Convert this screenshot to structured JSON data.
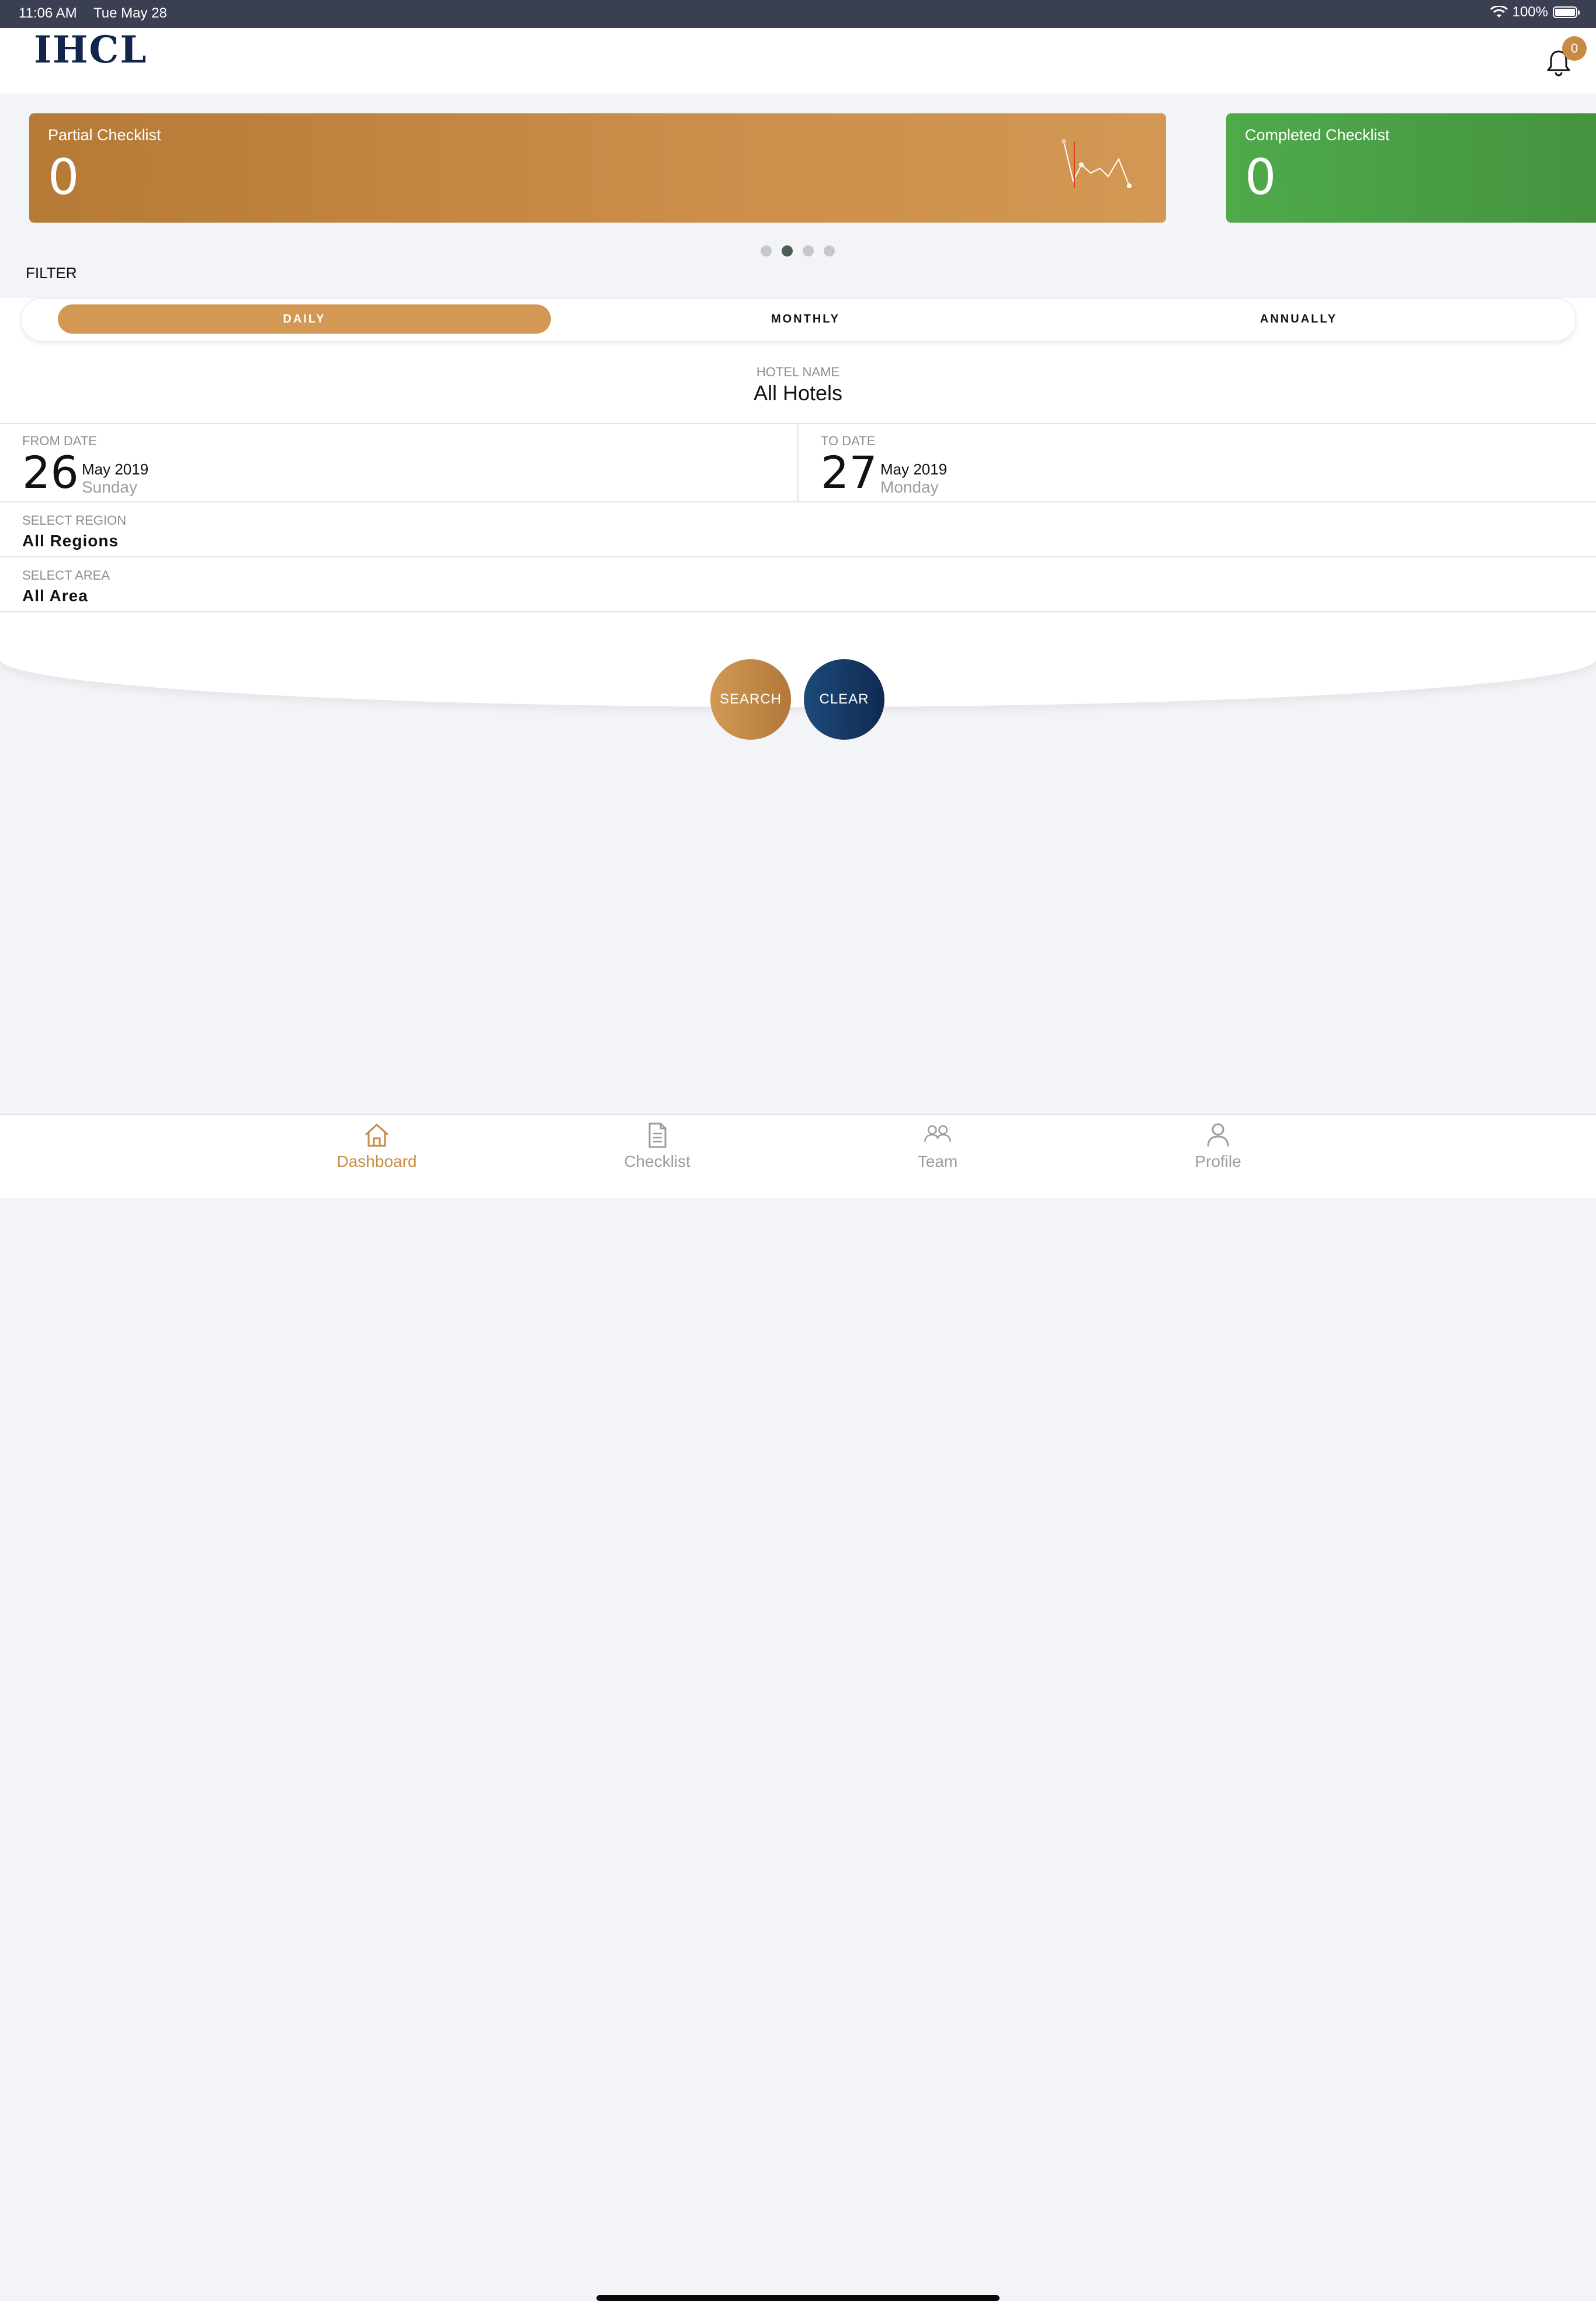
{
  "status_bar": {
    "time": "11:06 AM",
    "date": "Tue May 28",
    "battery": "100%"
  },
  "header": {
    "logo": "IHCL",
    "notification_count": "0"
  },
  "cards": [
    {
      "title": "Partial Checklist",
      "value": "0",
      "color": "#c88b43"
    },
    {
      "title": "Completed Checklist",
      "value": "0",
      "color": "#4caa48"
    }
  ],
  "carousel": {
    "pages": 4,
    "active": 2
  },
  "filter": {
    "label": "FILTER",
    "tabs": [
      "DAILY",
      "MONTHLY",
      "ANNUALLY"
    ],
    "active_tab": "DAILY"
  },
  "form": {
    "hotel": {
      "label": "HOTEL NAME",
      "value": "All Hotels"
    },
    "from_date": {
      "label": "FROM DATE",
      "day": "26",
      "month_year": "May 2019",
      "weekday": "Sunday"
    },
    "to_date": {
      "label": "TO DATE",
      "day": "27",
      "month_year": "May 2019",
      "weekday": "Monday"
    },
    "region": {
      "label": "SELECT REGION",
      "value": "All Regions"
    },
    "area": {
      "label": "SELECT AREA",
      "value": "All Area"
    }
  },
  "actions": {
    "search": "SEARCH",
    "clear": "CLEAR"
  },
  "tabbar": {
    "items": [
      {
        "label": "Dashboard",
        "icon": "home-icon"
      },
      {
        "label": "Checklist",
        "icon": "document-icon"
      },
      {
        "label": "Team",
        "icon": "team-icon"
      },
      {
        "label": "Profile",
        "icon": "profile-icon"
      }
    ],
    "active": "Dashboard"
  },
  "colors": {
    "accent": "#c88b43",
    "navy": "#12264d",
    "success": "#4caa48"
  }
}
